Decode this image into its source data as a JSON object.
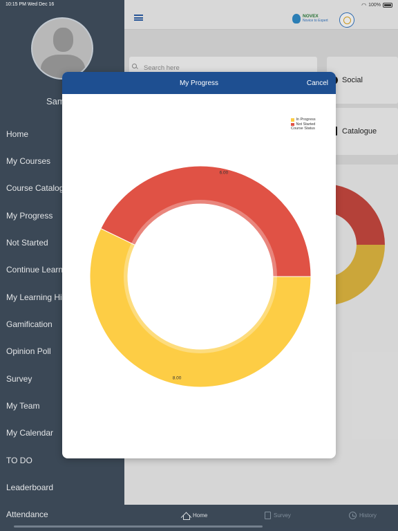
{
  "status_bar": {
    "time_date": "10:15 PM  Wed Dec 16",
    "battery": "100%"
  },
  "sidebar": {
    "user_name": "Sam",
    "items": [
      {
        "label": "Home"
      },
      {
        "label": "My Courses"
      },
      {
        "label": "Course Catalog"
      },
      {
        "label": "My Progress"
      },
      {
        "label": "Not Started"
      },
      {
        "label": "Continue Learn"
      },
      {
        "label": "My Learning Hi"
      },
      {
        "label": "Gamification"
      },
      {
        "label": "Opinion Poll"
      },
      {
        "label": "Survey"
      },
      {
        "label": "My Team"
      },
      {
        "label": "My Calendar"
      },
      {
        "label": "TO DO"
      },
      {
        "label": "Leaderboard"
      },
      {
        "label": "Attendance"
      }
    ]
  },
  "header": {
    "logo_title": "NOVEX",
    "logo_subtitle": "Novice to Expert"
  },
  "search": {
    "placeholder": "Search here"
  },
  "tiles": {
    "social": "Social",
    "catalogue": "Catalogue"
  },
  "tabbar": {
    "home": "Home",
    "survey": "Survey",
    "history": "History"
  },
  "modal": {
    "title": "My Progress",
    "cancel": "Cancel"
  },
  "chart_data": {
    "type": "pie",
    "donut": true,
    "title": "",
    "legend_title": "Course Status",
    "legend_position": "top-right",
    "categories": [
      "In Progress",
      "Not Started"
    ],
    "values": [
      8,
      6
    ],
    "value_labels": [
      "8.00",
      "6.00"
    ],
    "colors": [
      "#fdcd45",
      "#e05245"
    ]
  }
}
